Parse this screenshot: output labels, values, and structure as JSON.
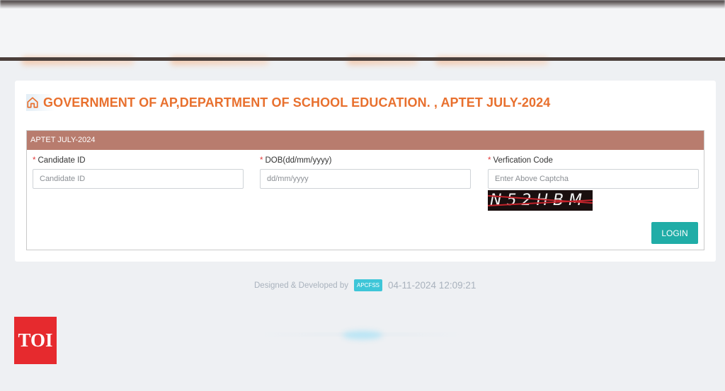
{
  "heading": {
    "title": "GOVERNMENT OF AP,DEPARTMENT OF SCHOOL EDUCATION. , APTET JULY-2024",
    "icon": "home-icon"
  },
  "panel": {
    "title": "APTET JULY-2024"
  },
  "fields": {
    "candidate_id": {
      "label": "Candidate ID",
      "placeholder": "Candidate ID",
      "required": "*"
    },
    "dob": {
      "label": "DOB(dd/mm/yyyy)",
      "placeholder": "dd/mm/yyyy",
      "required": "*"
    },
    "verification": {
      "label": "Verfication Code",
      "placeholder": "Enter Above Captcha",
      "required": "*"
    }
  },
  "captcha": {
    "text": "N52HBM"
  },
  "login": {
    "label": "LOGIN"
  },
  "footer": {
    "designed_by": "Designed & Developed by",
    "badge": "APCFSS",
    "timestamp": "04-11-2024 12:09:21"
  },
  "watermark": {
    "text": "TOI"
  },
  "colors": {
    "accent": "#e8702e",
    "panel_header": "#b87c6e",
    "button": "#20ada7",
    "badge": "#3ec6d8",
    "required": "#e23b3b"
  }
}
